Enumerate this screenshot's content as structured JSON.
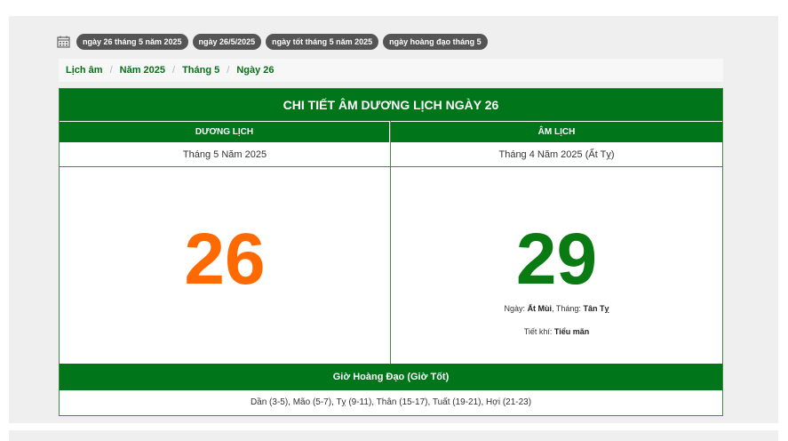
{
  "tags": [
    "ngày 26 tháng 5 năm 2025",
    "ngày 26/5/2025",
    "ngày tốt tháng 5 năm 2025",
    "ngày hoàng đạo tháng 5"
  ],
  "breadcrumb": [
    "Lịch âm",
    "Năm 2025",
    "Tháng 5",
    "Ngày 26"
  ],
  "card": {
    "title": "CHI TIẾT ÂM DƯƠNG LỊCH NGÀY 26",
    "solar": {
      "header": "DƯƠNG LỊCH",
      "month_year": "Tháng 5 Năm 2025",
      "day": "26"
    },
    "lunar": {
      "header": "ÂM LỊCH",
      "month_year": "Tháng 4 Năm 2025 (Ất Tỵ)",
      "day": "29",
      "day_label": "Ngày:",
      "day_value": "Ất Mùi",
      "month_label": "Tháng:",
      "month_value": "Tân Tỵ",
      "tietkhi_label": "Tiết khí:",
      "tietkhi_value": "Tiểu mãn"
    },
    "hours": {
      "header": "Giờ Hoàng Đạo (Giờ Tốt)",
      "list": "Dần (3-5), Mão (5-7), Tỵ (9-11), Thân (15-17), Tuất (19-21), Hợi (21-23)"
    }
  },
  "colors": {
    "green": "#00751a",
    "orange": "#ff6a00",
    "lunar_green": "#0a7a12",
    "tag_bg": "#555555"
  },
  "icons": {
    "calendar": "calendar-icon"
  }
}
